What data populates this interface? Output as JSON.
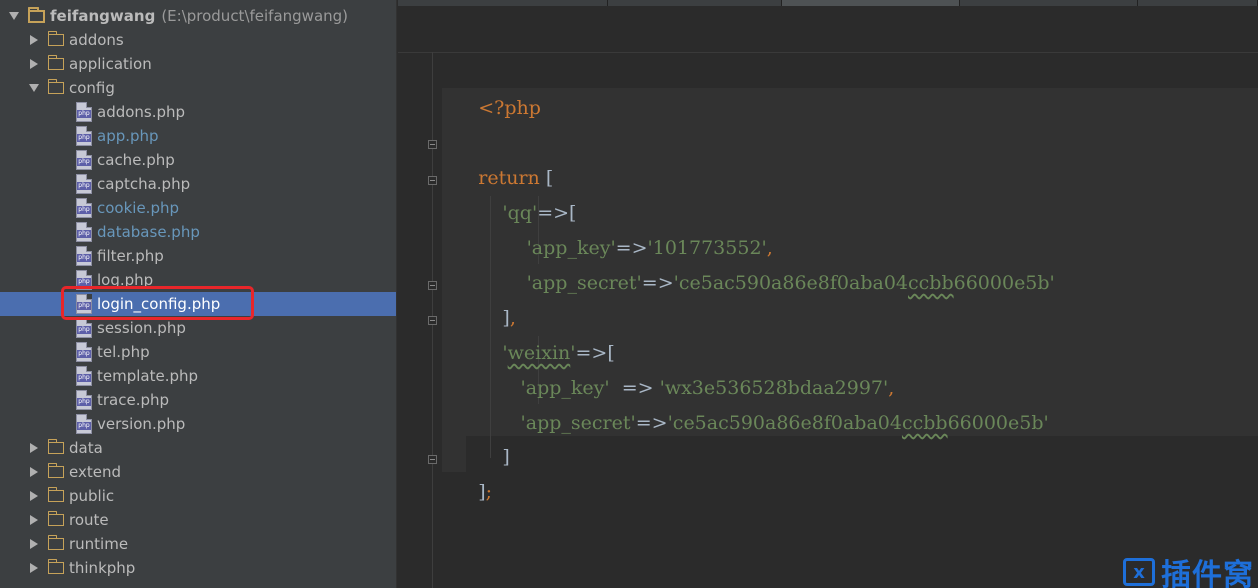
{
  "tree": {
    "root": {
      "name": "feifangwang",
      "path": "(E:\\product\\feifangwang)"
    },
    "items": [
      {
        "label": "addons",
        "type": "folder",
        "state": "collapsed"
      },
      {
        "label": "application",
        "type": "folder",
        "state": "collapsed"
      },
      {
        "label": "config",
        "type": "folder",
        "state": "expanded"
      },
      {
        "label": "addons.php",
        "type": "php"
      },
      {
        "label": "app.php",
        "type": "php",
        "modified": true
      },
      {
        "label": "cache.php",
        "type": "php"
      },
      {
        "label": "captcha.php",
        "type": "php"
      },
      {
        "label": "cookie.php",
        "type": "php",
        "modified": true
      },
      {
        "label": "database.php",
        "type": "php",
        "modified": true
      },
      {
        "label": "filter.php",
        "type": "php"
      },
      {
        "label": "log.php",
        "type": "php"
      },
      {
        "label": "login_config.php",
        "type": "php",
        "selected": true
      },
      {
        "label": "session.php",
        "type": "php"
      },
      {
        "label": "tel.php",
        "type": "php"
      },
      {
        "label": "template.php",
        "type": "php"
      },
      {
        "label": "trace.php",
        "type": "php"
      },
      {
        "label": "version.php",
        "type": "php"
      },
      {
        "label": "data",
        "type": "folder",
        "state": "collapsed"
      },
      {
        "label": "extend",
        "type": "folder",
        "state": "collapsed"
      },
      {
        "label": "public",
        "type": "folder",
        "state": "collapsed"
      },
      {
        "label": "route",
        "type": "folder",
        "state": "collapsed"
      },
      {
        "label": "runtime",
        "type": "folder",
        "state": "collapsed"
      },
      {
        "label": "thinkphp",
        "type": "folder",
        "state": "collapsed"
      }
    ],
    "file_icon_text": "php"
  },
  "code": {
    "open_tag": "<?php",
    "return_kw": "return",
    "open_bracket": "[",
    "qq_key": "'qq'",
    "arrow": "=>",
    "qq_app_key_key": "'app_key'",
    "qq_app_key_val": "'101773552'",
    "comma": ",",
    "qq_app_secret_key": "'app_secret'",
    "qq_app_secret_pre": "'ce5ac590a86e8f0aba04",
    "qq_app_secret_wavy": "ccbb",
    "qq_app_secret_post": "66000e5b'",
    "close_inner": "]",
    "weixin_quote_open": "'",
    "weixin_word": "weixin",
    "weixin_quote_close": "'",
    "wx_app_key_key": "'app_key'",
    "wx_arrow": "=>",
    "wx_app_key_val": "'wx3e536528bdaa2997'",
    "wx_app_secret_key": "'app_secret'",
    "wx_app_secret_pre": "'ce5ac590a86e8f0aba04",
    "wx_app_secret_wavy": "ccbb",
    "wx_app_secret_post": "66000e5b'",
    "close_outer": "]",
    "semicolon": ";"
  },
  "colors": {
    "keyword": "#cc7832",
    "string": "#6a8759",
    "plain": "#a9b7c6",
    "selection": "#4b6eaf",
    "highlight": "#e8262a"
  },
  "watermark": {
    "box_text": "x",
    "text": "插件窝"
  }
}
